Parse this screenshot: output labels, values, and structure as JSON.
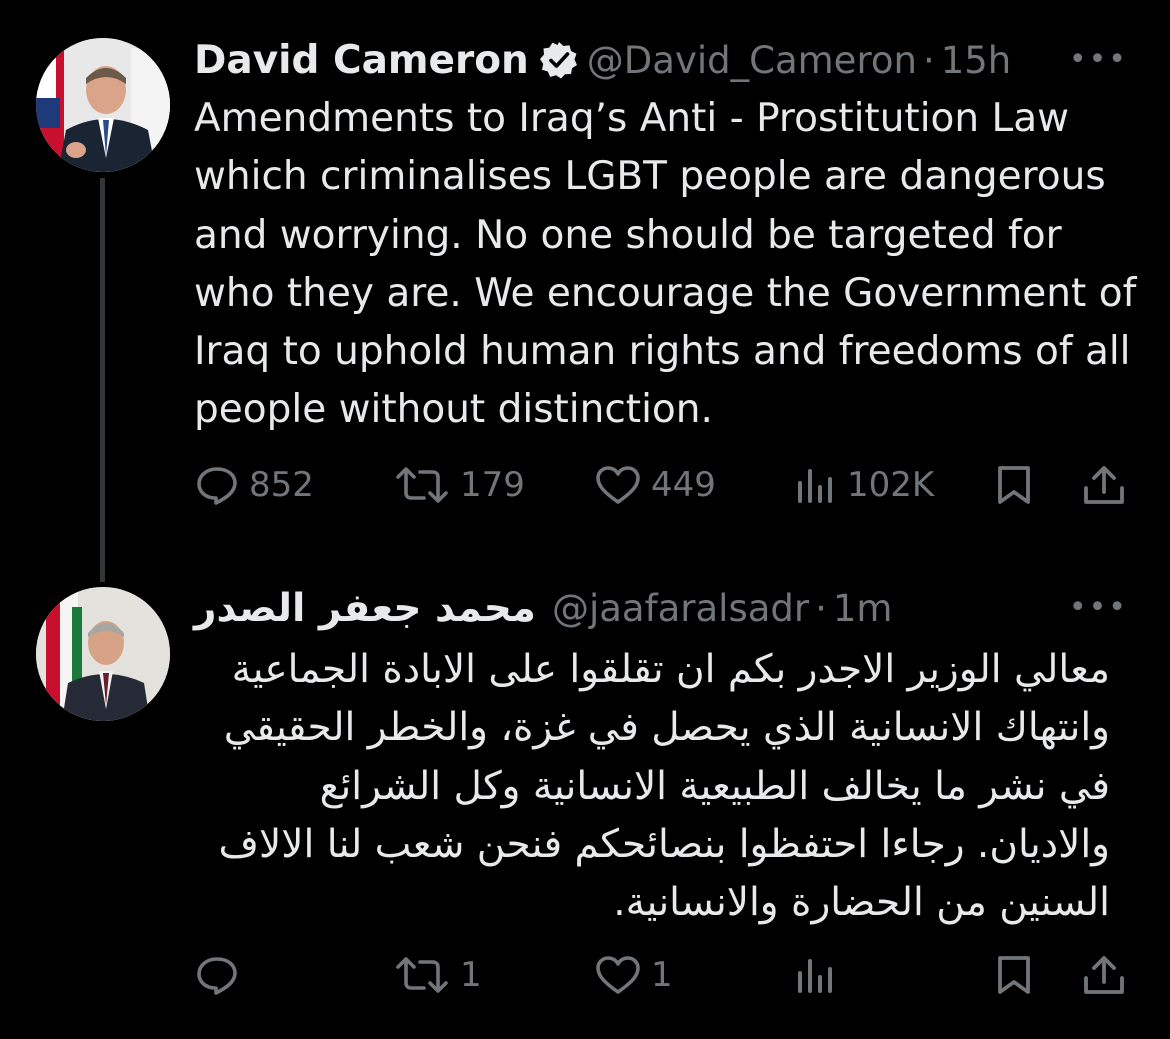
{
  "tweets": [
    {
      "name": "David Cameron",
      "handle": "@David_Cameron",
      "separator": "·",
      "time": "15h",
      "more": "•••",
      "verified": true,
      "text": "Amendments to Iraq’s Anti - Prostitution Law which criminalises LGBT people are dangerous and worrying. No one should be targeted for who they are. We encourage the Government of Iraq to uphold human rights and freedoms of all people without distinction.",
      "replies": "852",
      "reposts": "179",
      "likes": "449",
      "views": "102K"
    },
    {
      "name": "محمد جعفر الصدر",
      "handle": "@jaafaralsadr",
      "separator": "·",
      "time": "1m",
      "more": "•••",
      "verified": false,
      "text": "معالي الوزير الاجدر بكم ان تقلقوا على الابادة الجماعية وانتهاك الانسانية الذي يحصل في غزة، والخطر الحقيقي في نشر ما يخالف الطبيعية الانسانية وكل الشرائع والاديان. رجاءا احتفظوا بنصائحكم فنحن شعب لنا الالاف السنين من الحضارة والانسانية.",
      "replies": "",
      "reposts": "1",
      "likes": "1",
      "views": ""
    }
  ],
  "icons": {
    "reply": "reply-icon",
    "repost": "repost-icon",
    "like": "like-icon",
    "views": "views-icon",
    "bookmark": "bookmark-icon",
    "share": "share-icon",
    "verified": "verified-badge-icon"
  },
  "colors": {
    "background": "#000000",
    "text": "#e7e9ea",
    "secondary": "#71767b",
    "verified": "#e7e9ea"
  }
}
